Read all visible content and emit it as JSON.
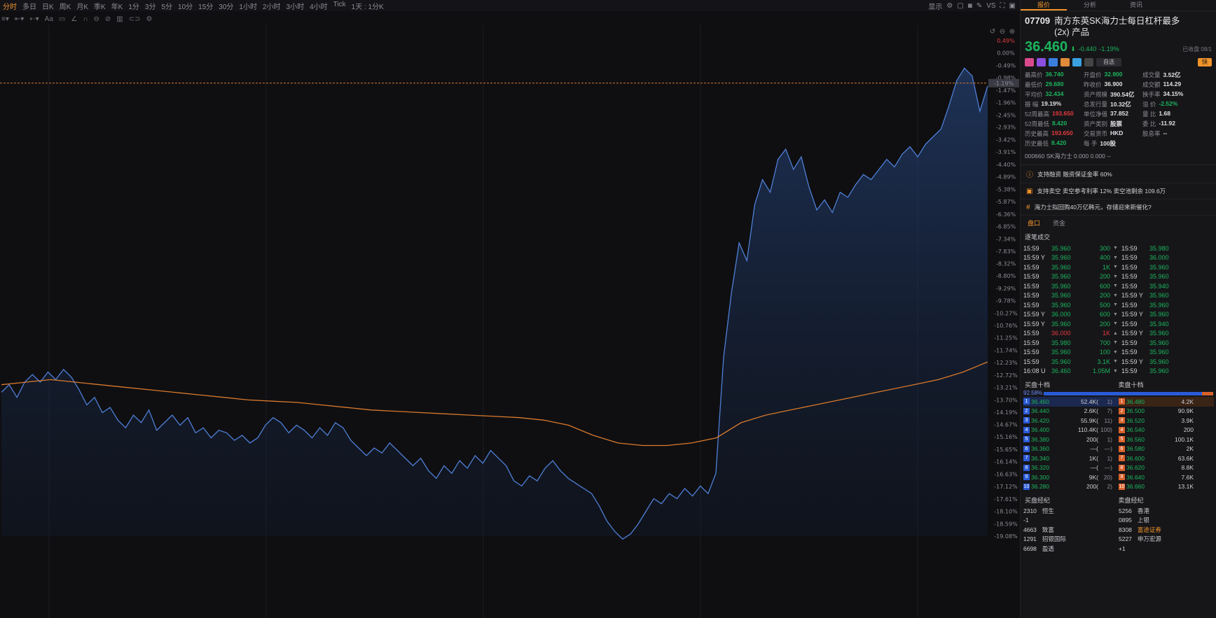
{
  "toolbar": {
    "period_tabs": [
      "分时",
      "多日",
      "日K",
      "周K",
      "月K",
      "季K",
      "年K",
      "1分",
      "3分",
      "5分",
      "10分",
      "15分",
      "30分",
      "1小时",
      "2小时",
      "3小时",
      "4小时",
      "Tick",
      "1天 : 1分K"
    ],
    "active_tab": "分时",
    "display_label": "显示",
    "vs_label": "VS"
  },
  "chart_data": {
    "type": "area",
    "title": "",
    "yaxis_right_percent": [
      "0.49%",
      "0.00%",
      "-0.49%",
      "-0.98%",
      "-1.47%",
      "-1.96%",
      "-2.45%",
      "-2.93%",
      "-3.42%",
      "-3.91%",
      "-4.40%",
      "-4.89%",
      "-5.38%",
      "-5.87%",
      "-6.36%",
      "-6.85%",
      "-7.34%",
      "-7.83%",
      "-8.32%",
      "-8.80%",
      "-9.29%",
      "-9.78%",
      "-10.27%",
      "-10.76%",
      "-11.25%",
      "-11.74%",
      "-12.23%",
      "-12.72%",
      "-13.21%",
      "-13.70%",
      "-14.19%",
      "-14.67%",
      "-15.16%",
      "-15.65%",
      "-16.14%",
      "-16.63%",
      "-17.12%",
      "-17.61%",
      "-18.10%",
      "-18.59%",
      "-19.08%"
    ],
    "current_pct_label": "-1.19%",
    "series": [
      {
        "name": "price_pct",
        "color": "#4f7fd6",
        "values": [
          -13.4,
          -13.1,
          -13.6,
          -13.0,
          -12.7,
          -13.0,
          -12.6,
          -12.9,
          -12.5,
          -12.8,
          -13.3,
          -13.9,
          -13.6,
          -14.2,
          -14.0,
          -14.5,
          -14.8,
          -14.3,
          -14.6,
          -14.1,
          -14.9,
          -14.6,
          -14.3,
          -14.7,
          -14.4,
          -15.0,
          -14.8,
          -15.2,
          -14.9,
          -15.0,
          -15.3,
          -15.1,
          -15.4,
          -15.2,
          -14.7,
          -14.4,
          -14.6,
          -15.0,
          -14.7,
          -14.9,
          -15.2,
          -14.8,
          -15.1,
          -14.6,
          -14.8,
          -15.3,
          -15.6,
          -15.9,
          -15.6,
          -15.8,
          -15.4,
          -15.7,
          -16.0,
          -16.3,
          -16.0,
          -16.5,
          -16.8,
          -16.3,
          -16.6,
          -16.1,
          -16.4,
          -15.9,
          -16.2,
          -15.7,
          -16.0,
          -16.3,
          -16.9,
          -17.1,
          -16.7,
          -16.9,
          -16.4,
          -16.1,
          -16.5,
          -16.8,
          -17.0,
          -17.2,
          -17.4,
          -17.9,
          -18.5,
          -18.9,
          -19.2,
          -19.0,
          -18.6,
          -18.1,
          -17.6,
          -17.8,
          -17.4,
          -17.6,
          -17.2,
          -17.5,
          -17.1,
          -17.4,
          -16.6,
          -12.0,
          -9.5,
          -7.5,
          -8.2,
          -6.0,
          -5.0,
          -5.5,
          -4.2,
          -3.8,
          -4.6,
          -4.1,
          -5.3,
          -6.2,
          -5.8,
          -6.3,
          -5.5,
          -5.7,
          -5.2,
          -4.8,
          -5.0,
          -4.6,
          -4.2,
          -4.5,
          -4.0,
          -3.7,
          -4.1,
          -3.6,
          -3.3,
          -3.0,
          -2.1,
          -1.1,
          -0.6,
          -0.9,
          -2.3,
          -1.3
        ]
      },
      {
        "name": "avg_price_pct",
        "color": "#d9792b",
        "values": [
          -13.1,
          -13.0,
          -12.9,
          -13.0,
          -13.1,
          -13.2,
          -13.3,
          -13.4,
          -13.5,
          -13.6,
          -13.7,
          -13.75,
          -13.8,
          -13.9,
          -14.0,
          -14.1,
          -14.15,
          -14.2,
          -14.25,
          -14.3,
          -14.35,
          -14.4,
          -14.5,
          -14.7,
          -15.1,
          -15.4,
          -15.5,
          -15.5,
          -15.4,
          -15.2,
          -14.6,
          -14.3,
          -14.1,
          -13.9,
          -13.7,
          -13.5,
          -13.3,
          -13.1,
          -12.9,
          -12.6,
          -12.2
        ]
      }
    ],
    "reference_line_pct": -1.19
  },
  "panel": {
    "tabs": [
      "报价",
      "分析",
      "资讯"
    ],
    "active_tab": "报价",
    "code": "07709",
    "name_line1": "南方东英SK海力士每日杠杆最多",
    "name_line2": "(2x) 产品",
    "price": "36.460",
    "arrow": "⬇",
    "change": "-0.440",
    "change_pct": "-1.19%",
    "closed_text": "已收盘 08/1",
    "watch_label": "自选",
    "fast_label": "快",
    "stats": [
      {
        "k": "最高价",
        "v": "36.740",
        "c": "dn"
      },
      {
        "k": "开盘价",
        "v": "32.900",
        "c": "dn"
      },
      {
        "k": "成交量",
        "v": "3.52亿",
        "c": ""
      },
      {
        "k": "最低价",
        "v": "29.680",
        "c": "dn"
      },
      {
        "k": "昨收价",
        "v": "36.900",
        "c": ""
      },
      {
        "k": "成交额",
        "v": "114.29",
        "c": ""
      },
      {
        "k": "平均价",
        "v": "32.434",
        "c": "dn"
      },
      {
        "k": "资产规模",
        "v": "390.54亿",
        "c": ""
      },
      {
        "k": "换手率",
        "v": "34.15%",
        "c": ""
      },
      {
        "k": "振 幅",
        "v": "19.19%",
        "c": ""
      },
      {
        "k": "总发行量",
        "v": "10.32亿",
        "c": ""
      },
      {
        "k": "溢 价",
        "v": "-2.52%",
        "c": "dn"
      },
      {
        "k": "52周最高",
        "v": "193.650",
        "c": "up"
      },
      {
        "k": "单位净值",
        "v": "37.852",
        "c": ""
      },
      {
        "k": "量 比",
        "v": "1.68",
        "c": ""
      },
      {
        "k": "52周最低",
        "v": "8.420",
        "c": "dn"
      },
      {
        "k": "资产类别",
        "v": "股票",
        "c": ""
      },
      {
        "k": "委 比",
        "v": "-11.92",
        "c": ""
      },
      {
        "k": "历史最高",
        "v": "193.650",
        "c": "up"
      },
      {
        "k": "交易货币",
        "v": "HKD",
        "c": ""
      },
      {
        "k": "股息率",
        "v": "--",
        "c": ""
      },
      {
        "k": "历史最低",
        "v": "8.420",
        "c": "dn"
      },
      {
        "k": "每 手",
        "v": "100股",
        "c": ""
      }
    ],
    "underlying": "000660  SK海力士   0.000   0.000   --",
    "info": [
      "支持融资  融资保证金率 60%",
      "支持卖空  卖空参考利率 12%  卖空池剩余 109.6万",
      "海力士拟回购40万亿韩元，存储迎来新催化?"
    ],
    "subtabs": [
      "盘口",
      "资金"
    ],
    "trades_header": "逐笔成交",
    "trades_left": [
      {
        "t": "15:59",
        "p": "35.960",
        "v": "300",
        "up": false
      },
      {
        "t": "15:59 Y",
        "p": "35.960",
        "v": "400",
        "up": false
      },
      {
        "t": "15:59",
        "p": "35.960",
        "v": "1K",
        "up": false
      },
      {
        "t": "15:59",
        "p": "35.960",
        "v": "200",
        "up": false
      },
      {
        "t": "15:59",
        "p": "35.960",
        "v": "600",
        "up": false
      },
      {
        "t": "15:59",
        "p": "35.960",
        "v": "200",
        "up": false
      },
      {
        "t": "15:59",
        "p": "35.960",
        "v": "500",
        "up": false
      },
      {
        "t": "15:59 Y",
        "p": "36.000",
        "v": "600",
        "up": false
      },
      {
        "t": "15:59 Y",
        "p": "35.960",
        "v": "200",
        "up": false
      },
      {
        "t": "15:59",
        "p": "36.000",
        "v": "1K",
        "up": true
      },
      {
        "t": "15:59",
        "p": "35.980",
        "v": "700",
        "up": false
      },
      {
        "t": "15:59",
        "p": "35.960",
        "v": "100",
        "up": false
      },
      {
        "t": "15:59",
        "p": "35.960",
        "v": "3.1K",
        "up": false
      },
      {
        "t": "16:08 U",
        "p": "36.460",
        "v": "1.05M",
        "up": false
      }
    ],
    "trades_right": [
      {
        "t": "15:59",
        "p": "35.980"
      },
      {
        "t": "15:59",
        "p": "36.000"
      },
      {
        "t": "15:59",
        "p": "35.960"
      },
      {
        "t": "15:59",
        "p": "35.960"
      },
      {
        "t": "15:59",
        "p": "35.940"
      },
      {
        "t": "15:59 Y",
        "p": "35.960"
      },
      {
        "t": "15:59",
        "p": "35.960"
      },
      {
        "t": "15:59 Y",
        "p": "35.960"
      },
      {
        "t": "15:59",
        "p": "35.940"
      },
      {
        "t": "15:59 Y",
        "p": "35.960"
      },
      {
        "t": "15:59",
        "p": "35.960"
      },
      {
        "t": "15:59",
        "p": "35.960"
      },
      {
        "t": "15:59 Y",
        "p": "35.960"
      },
      {
        "t": "15:59",
        "p": "35.960"
      }
    ],
    "ob_bid_title": "买盘十档",
    "ob_ask_title": "卖盘十档",
    "ob_bid_pct": "92.58%",
    "bids": [
      {
        "p": "36.460",
        "v": "52.4K(",
        "n": "1)"
      },
      {
        "p": "36.440",
        "v": "2.6K(",
        "n": "7)"
      },
      {
        "p": "36.420",
        "v": "55.9K(",
        "n": "11)"
      },
      {
        "p": "36.400",
        "v": "110.4K(",
        "n": "100)"
      },
      {
        "p": "36.380",
        "v": "200(",
        "n": "1)"
      },
      {
        "p": "36.360",
        "v": "—(",
        "n": "—)"
      },
      {
        "p": "36.340",
        "v": "1K(",
        "n": "1)"
      },
      {
        "p": "36.320",
        "v": "—(",
        "n": "—)"
      },
      {
        "p": "36.300",
        "v": "9K(",
        "n": "20)"
      },
      {
        "p": "36.280",
        "v": "200(",
        "n": "2)"
      }
    ],
    "asks": [
      {
        "p": "36.480",
        "v": "4.2K"
      },
      {
        "p": "36.500",
        "v": "90.9K"
      },
      {
        "p": "36.520",
        "v": "3.9K"
      },
      {
        "p": "36.540",
        "v": "200"
      },
      {
        "p": "36.560",
        "v": "100.1K"
      },
      {
        "p": "36.580",
        "v": "2K"
      },
      {
        "p": "36.600",
        "v": "63.6K"
      },
      {
        "p": "36.620",
        "v": "8.8K"
      },
      {
        "p": "36.640",
        "v": "7.6K"
      },
      {
        "p": "36.660",
        "v": "13.1K"
      }
    ],
    "broker_bid_title": "买盘经纪",
    "broker_ask_title": "卖盘经纪",
    "brokers_left": [
      {
        "id": "2310",
        "name": "恒生",
        "hl": false
      },
      {
        "id": "-1",
        "name": "",
        "hl": false
      },
      {
        "id": "4663",
        "name": "致富",
        "hl": false
      },
      {
        "id": "1291",
        "name": "招银国际",
        "hl": false
      },
      {
        "id": "6698",
        "name": "盈透",
        "hl": false
      }
    ],
    "brokers_right": [
      {
        "id": "5256",
        "name": "香港",
        "hl": false
      },
      {
        "id": "0895",
        "name": "上银",
        "hl": false
      },
      {
        "id": "8308",
        "name": "富途证券",
        "hl": true
      },
      {
        "id": "5227",
        "name": "申万宏源",
        "hl": false
      },
      {
        "id": "+1",
        "name": "",
        "hl": false
      }
    ]
  }
}
